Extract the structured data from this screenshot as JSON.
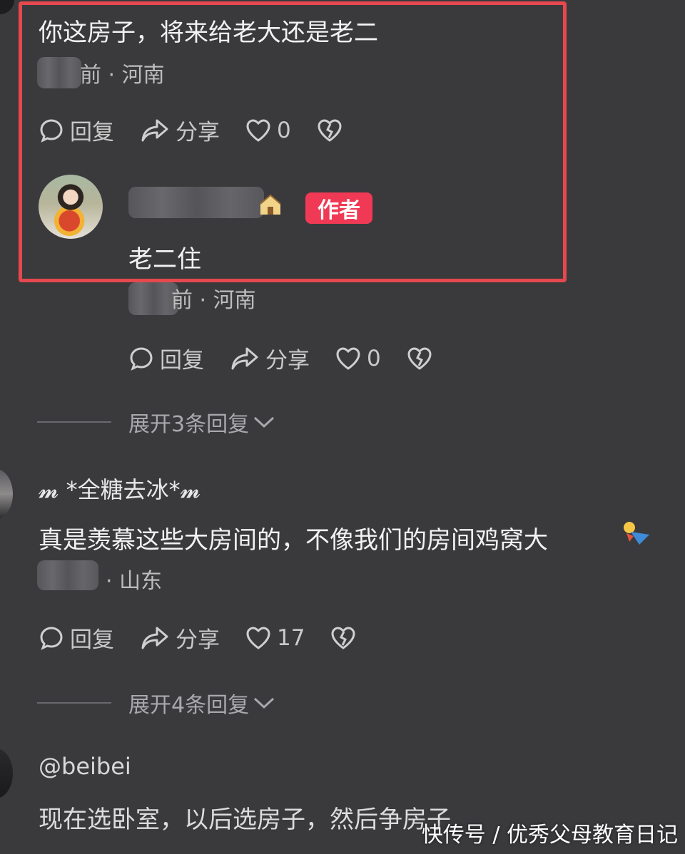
{
  "comments": [
    {
      "text": "你这房子，将来给老大还是老二",
      "meta_suffix": "前 · 河南",
      "actions": {
        "reply": "回复",
        "share": "分享",
        "likes": "0"
      }
    },
    {
      "author_badge": "作者",
      "text": "老二住",
      "meta_suffix": "前 · 河南",
      "actions": {
        "reply": "回复",
        "share": "分享",
        "likes": "0"
      },
      "expand": "展开3条回复"
    },
    {
      "username": "𝓶 *全糖去冰*𝓶",
      "text": "真是羡慕这些大房间的，不像我们的房间鸡窝大",
      "meta_suffix": "· 山东",
      "actions": {
        "reply": "回复",
        "share": "分享",
        "likes": "17"
      },
      "expand": "展开4条回复"
    },
    {
      "username": "@beibei",
      "text": "现在选卧室，以后选房子，然后争房子"
    }
  ],
  "watermark": "快传号 / 优秀父母教育日记",
  "colors": {
    "background": "#3a3a3d",
    "highlight": "#e5484e",
    "badge": "#f03a55"
  }
}
